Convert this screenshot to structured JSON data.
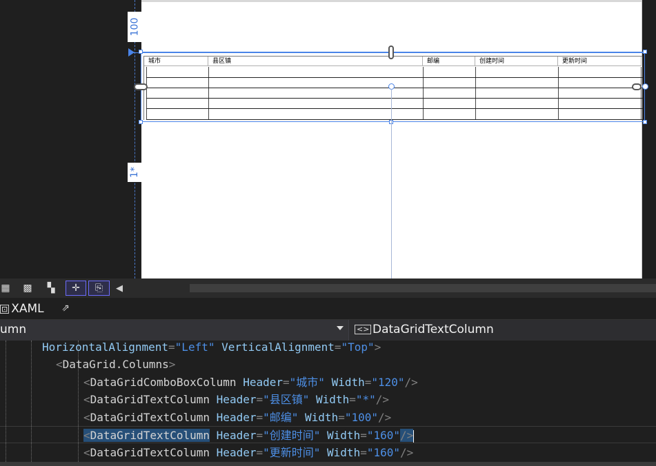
{
  "designer": {
    "row_labels": {
      "top_row_height": "100",
      "bottom_row_height": "1*"
    },
    "datagrid": {
      "headers": [
        "城市",
        "县区镇",
        "邮编",
        "创建时间",
        "更新时间"
      ],
      "empty_row_count": 5
    }
  },
  "toolbar": {
    "icons": [
      "grid-icon",
      "snap-grid-icon",
      "checkerboard-icon",
      "snap-lines-icon",
      "device-preview-icon"
    ],
    "scroll_left_icon": "◀"
  },
  "tabs": {
    "xaml_label": "XAML",
    "xaml_icon": "⊡",
    "popout_icon": "⇗"
  },
  "nav": {
    "left_selector": "umn",
    "right_icon": "<>",
    "right_selector": "DataGridTextColumn"
  },
  "code": {
    "line1": {
      "attr1": "HorizontalAlignment",
      "val1": "\"Left\"",
      "attr2": "VerticalAlignment",
      "val2": "\"Top\"",
      "close": ">"
    },
    "line2": {
      "open": "<",
      "tag": "DataGrid.Columns",
      "close": ">"
    },
    "line3": {
      "open": "<",
      "tag": "DataGridComboBoxColumn",
      "attr1": "Header",
      "val1": "\"城市\"",
      "attr2": "Width",
      "val2": "\"120\"",
      "close": "/>"
    },
    "line4": {
      "open": "<",
      "tag": "DataGridTextColumn",
      "attr1": "Header",
      "val1": "\"县区镇\"",
      "attr2": "Width",
      "val2": "\"*\"",
      "close": "/>"
    },
    "line5": {
      "open": "<",
      "tag": "DataGridTextColumn",
      "attr1": "Header",
      "val1": "\"邮编\"",
      "attr2": "Width",
      "val2": "\"100\"",
      "close": "/>"
    },
    "line6": {
      "open": "<",
      "tag": "DataGridTextColumn",
      "attr1": "Header",
      "val1": "\"创建时间\"",
      "attr2": "Width",
      "val2": "\"160\"",
      "close": "/>"
    },
    "line7": {
      "open": "<",
      "tag": "DataGridTextColumn",
      "attr1": "Header",
      "val1": "\"更新时间\"",
      "attr2": "Width",
      "val2": "\"160\"",
      "close": "/>"
    }
  },
  "colors": {
    "attribute": "#92caf4",
    "value": "#4d8fe6",
    "punctuation": "#808080",
    "selection": "#264f78",
    "designer_accent": "#4a84e8"
  }
}
